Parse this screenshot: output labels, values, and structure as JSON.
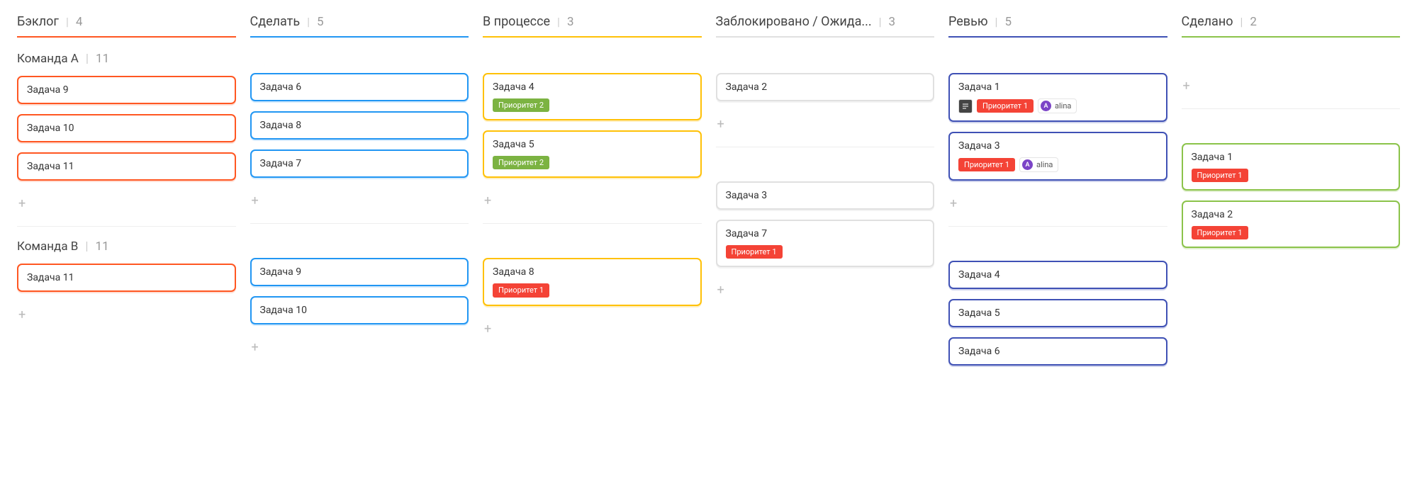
{
  "columns": [
    {
      "id": "backlog",
      "title": "Бэклог",
      "count": 4
    },
    {
      "id": "todo",
      "title": "Сделать",
      "count": 5
    },
    {
      "id": "progress",
      "title": "В процессе",
      "count": 3
    },
    {
      "id": "blocked",
      "title": "Заблокировано / Ожида...",
      "count": 3
    },
    {
      "id": "review",
      "title": "Ревью",
      "count": 5
    },
    {
      "id": "done",
      "title": "Сделано",
      "count": 2
    }
  ],
  "swimlanes": [
    {
      "id": "teamA",
      "title": "Команда А",
      "count": 11
    },
    {
      "id": "teamB",
      "title": "Команда В",
      "count": 11
    }
  ],
  "priority_labels": {
    "p1": "Приоритет 1",
    "p2": "Приоритет 2"
  },
  "assignee": {
    "alina": "alina",
    "alina_initial": "A"
  },
  "cards": {
    "teamA": {
      "backlog": [
        {
          "title": "Задача 9"
        },
        {
          "title": "Задача 10"
        },
        {
          "title": "Задача 11"
        }
      ],
      "todo": [
        {
          "title": "Задача 6"
        },
        {
          "title": "Задача 8"
        },
        {
          "title": "Задача 7"
        }
      ],
      "progress": [
        {
          "title": "Задача 4",
          "priority": "p2"
        },
        {
          "title": "Задача 5",
          "priority": "p2"
        }
      ],
      "blocked": [
        {
          "title": "Задача  2"
        }
      ],
      "review": [
        {
          "title": "Задача 1",
          "priority": "p1",
          "has_desc": true,
          "assignee": "alina"
        },
        {
          "title": "Задача 3",
          "priority": "p1",
          "assignee": "alina"
        }
      ],
      "done": []
    },
    "teamB": {
      "backlog": [
        {
          "title": "Задача 11"
        }
      ],
      "todo": [
        {
          "title": "Задача 9"
        },
        {
          "title": "Задача 10"
        }
      ],
      "progress": [
        {
          "title": "Задача 8",
          "priority": "p1"
        }
      ],
      "blocked": [
        {
          "title": "Задача 3"
        },
        {
          "title": "Задача 7",
          "priority": "p1"
        }
      ],
      "review": [
        {
          "title": "Задача 4"
        },
        {
          "title": "Задача 5"
        },
        {
          "title": "Задача 6"
        }
      ],
      "done": [
        {
          "title": "Задача 1",
          "priority": "p1"
        },
        {
          "title": "Задача 2",
          "priority": "p1"
        }
      ]
    }
  }
}
